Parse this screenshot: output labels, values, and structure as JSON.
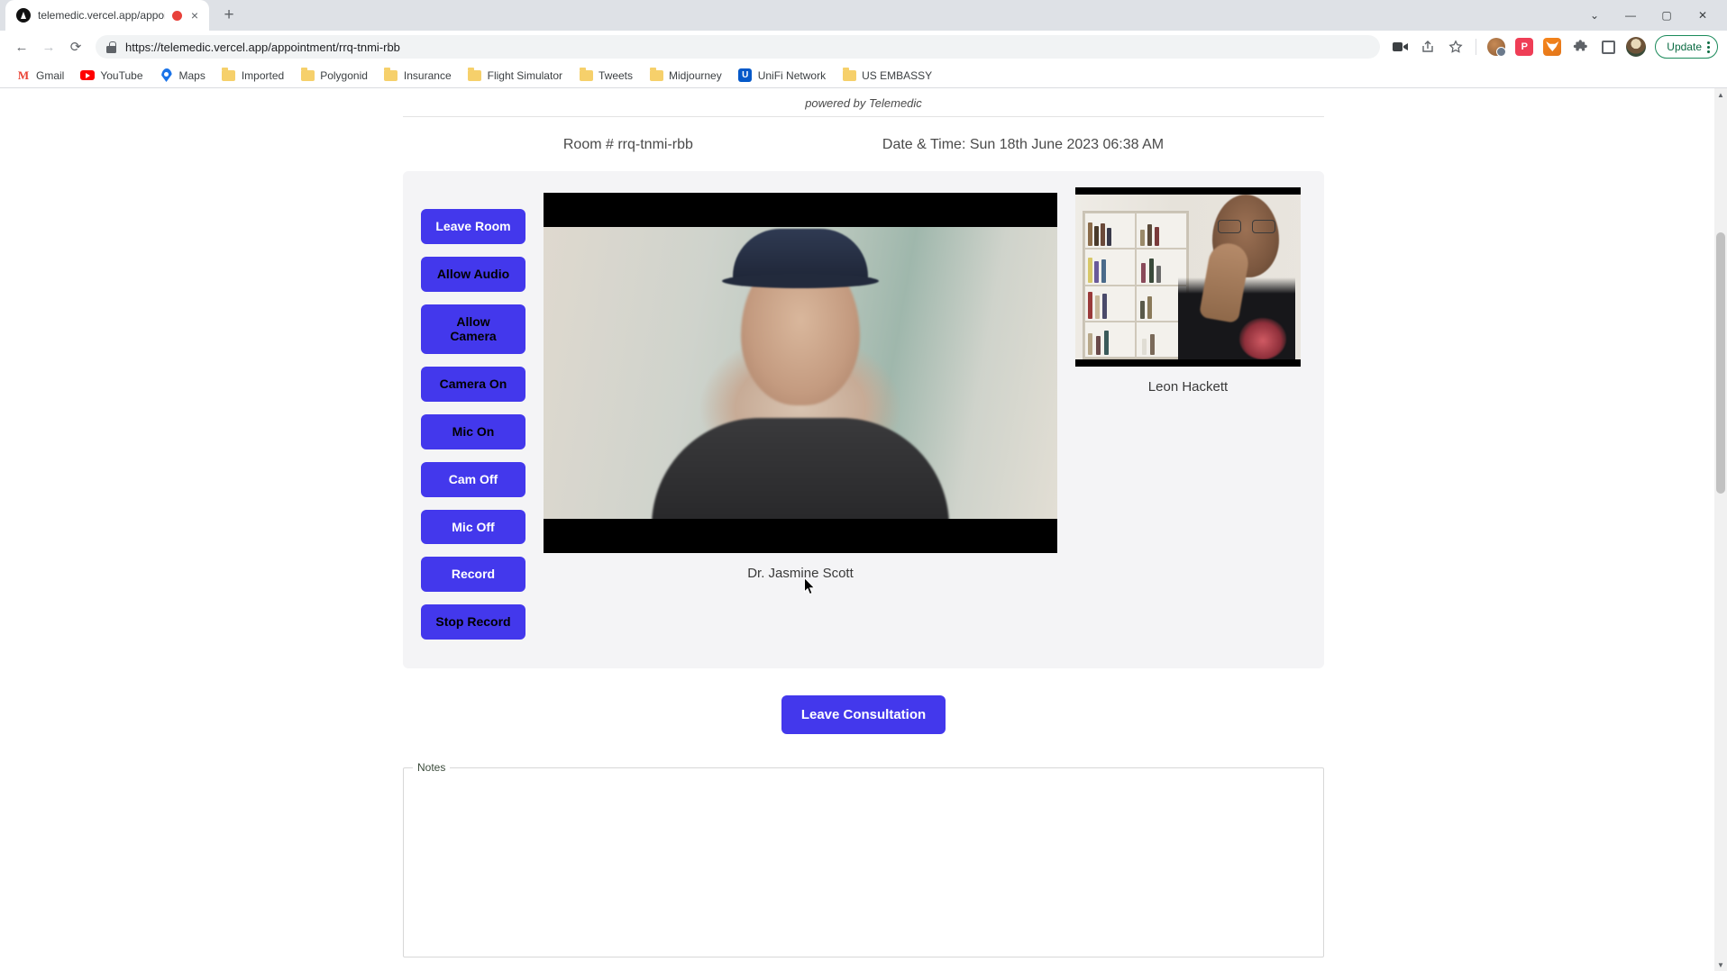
{
  "browser": {
    "tab": {
      "title": "telemedic.vercel.app/appoin",
      "favicon": "vercel-triangle-icon",
      "recording_indicator": "record-dot-icon",
      "close": "×"
    },
    "new_tab_label": "+",
    "window_controls": {
      "minimize": "—",
      "maximize": "▢",
      "close": "✕",
      "chevron": "⌄"
    },
    "nav": {
      "back": "←",
      "forward": "→",
      "reload": "⟳"
    },
    "omnibox": {
      "url": "https://telemedic.vercel.app/appointment/rrq-tnmi-rbb",
      "lock": "lock-icon"
    },
    "toolbar_icons": [
      "video-camera-icon",
      "share-icon",
      "bookmark-star-icon"
    ],
    "extensions": [
      "monkey-avatar-extension-icon",
      "pocket-extension-icon",
      "metamask-fox-extension-icon",
      "puzzle-extensions-icon",
      "sidebar-toggle-icon"
    ],
    "profile": "profile-avatar",
    "update_button": {
      "label": "Update",
      "menu": "kebab-menu-icon"
    },
    "bookmarks": [
      {
        "label": "Gmail",
        "icon": "gmail-icon"
      },
      {
        "label": "YouTube",
        "icon": "youtube-icon"
      },
      {
        "label": "Maps",
        "icon": "maps-pin-icon"
      },
      {
        "label": "Imported",
        "icon": "folder-icon"
      },
      {
        "label": "Polygonid",
        "icon": "folder-icon"
      },
      {
        "label": "Insurance",
        "icon": "folder-icon"
      },
      {
        "label": "Flight Simulator",
        "icon": "folder-icon"
      },
      {
        "label": "Tweets",
        "icon": "folder-icon"
      },
      {
        "label": "Midjourney",
        "icon": "folder-icon"
      },
      {
        "label": "UniFi Network",
        "icon": "unifi-icon"
      },
      {
        "label": "US EMBASSY",
        "icon": "folder-icon"
      }
    ]
  },
  "page": {
    "powered_by": "powered by Telemedic",
    "room_label": "Room # rrq-tnmi-rbb",
    "datetime_label": "Date & Time: Sun 18th June 2023 06:38 AM",
    "controls": [
      {
        "label": "Leave Room",
        "text_color": "#ffffff"
      },
      {
        "label": "Allow Audio",
        "text_color": "#000000"
      },
      {
        "label": "Allow\nCamera",
        "text_color": "#000000"
      },
      {
        "label": "Camera On",
        "text_color": "#000000"
      },
      {
        "label": "Mic On",
        "text_color": "#000000"
      },
      {
        "label": "Cam Off",
        "text_color": "#ffffff"
      },
      {
        "label": "Mic Off",
        "text_color": "#ffffff"
      },
      {
        "label": "Record",
        "text_color": "#ffffff"
      },
      {
        "label": "Stop Record",
        "text_color": "#000000"
      }
    ],
    "main_participant": {
      "name": "Dr. Jasmine Scott"
    },
    "side_participant": {
      "name": "Leon Hackett"
    },
    "leave_consultation_label": "Leave Consultation",
    "notes": {
      "legend": "Notes",
      "value": "",
      "placeholder": ""
    },
    "accent_color": "#4338ec",
    "panel_bg": "#f4f4f6"
  }
}
